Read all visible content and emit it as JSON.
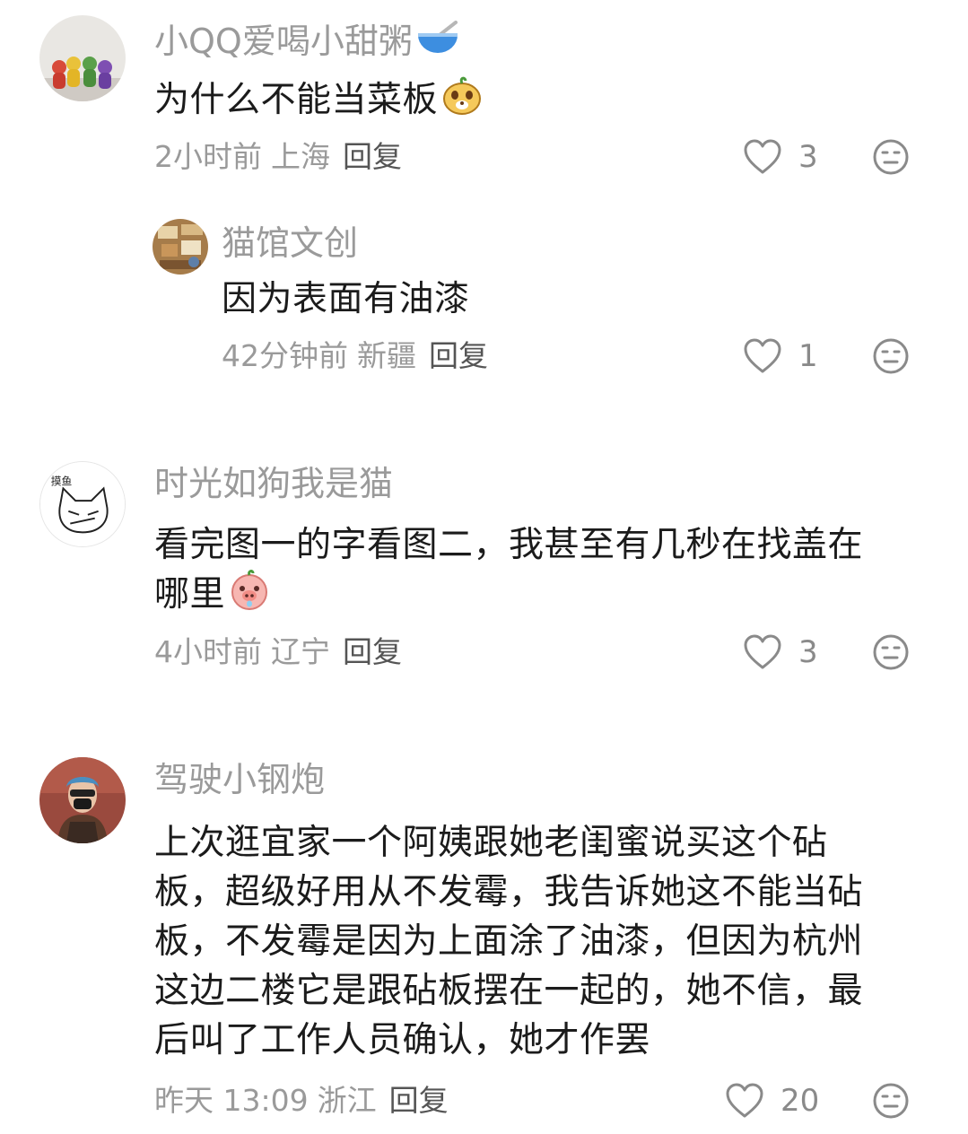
{
  "comments": [
    {
      "username": "小QQ爱喝小甜粥",
      "username_emoji": "bowl-icon",
      "text_lines": [
        "为什么不能当菜板"
      ],
      "text_emoji": "smile-dog-icon",
      "time": "2小时前",
      "location": "上海",
      "reply_label": "回复",
      "likes": "3",
      "replies": [
        {
          "username": "猫馆文创",
          "text_lines": [
            "因为表面有油漆"
          ],
          "time": "42分钟前",
          "location": "新疆",
          "reply_label": "回复",
          "likes": "1"
        }
      ]
    },
    {
      "username": "时光如狗我是猫",
      "text_lines": [
        "看完图一的字看图二，我甚至有几秒在找盖在",
        "哪里"
      ],
      "text_emoji": "pig-icon",
      "time": "4小时前",
      "location": "辽宁",
      "reply_label": "回复",
      "likes": "3"
    },
    {
      "username": "驾驶小钢炮",
      "text_lines": [
        "上次逛宜家一个阿姨跟她老闺蜜说买这个砧",
        "板，超级好用从不发霉，我告诉她这不能当砧",
        "板，不发霉是因为上面涂了油漆，但因为杭州",
        "这边二楼它是跟砧板摆在一起的，她不信，最",
        "后叫了工作人员确认，她才作罢"
      ],
      "time": "昨天 13:09",
      "location": "浙江",
      "reply_label": "回复",
      "likes": "20"
    }
  ],
  "colors": {
    "username": "#9a9a9a",
    "text": "#1b1b1b",
    "meta": "#9a9a9a",
    "reply": "#555555",
    "icon": "#8a8a8a"
  }
}
